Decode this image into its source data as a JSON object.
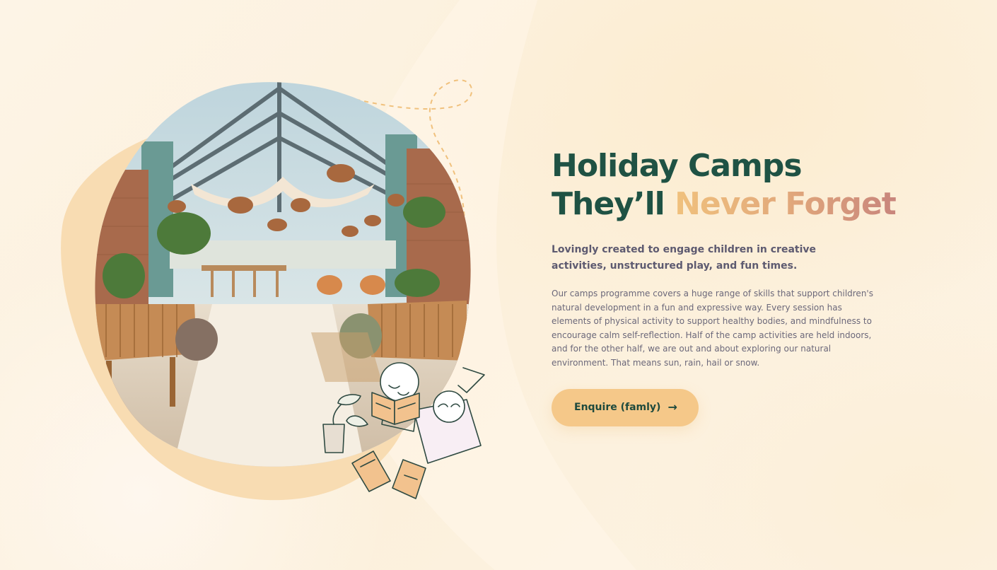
{
  "hero": {
    "title_line1": "Holiday Camps",
    "title_line2_plain": "They’ll ",
    "title_line2_accent": "Never Forget",
    "lead": "Lovingly created to engage children in creative activities, unstructured play, and fun times.",
    "body": "Our camps programme covers a huge range of skills that support children's natural development in a fun and expressive way. Every session has elements of physical activity to support healthy bodies, and mindfulness to encourage calm self-reflection. Half of the camp activities are held indoors, and for the other half, we are out and about exploring our natural environment. That means sun, rain, hail or snow.",
    "cta_label": "Enquire (famly)",
    "cta_icon": "arrow-right-icon"
  },
  "colors": {
    "heading": "#1f5244",
    "accent_start": "#f0c17d",
    "accent_end": "#c8857c",
    "button": "#f5c889",
    "blob": "#f8dcb2"
  }
}
